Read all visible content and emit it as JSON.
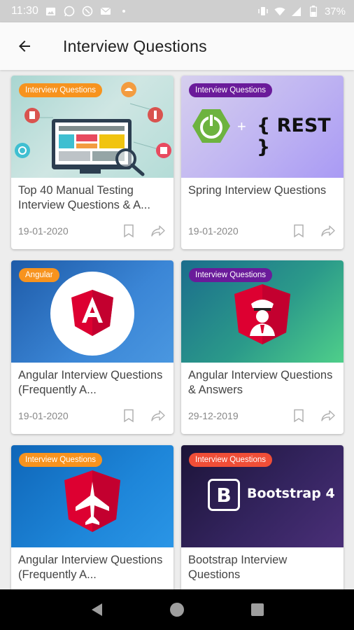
{
  "status_bar": {
    "time": "11:30",
    "battery": "37%"
  },
  "app_bar": {
    "title": "Interview Questions"
  },
  "colors": {
    "tag_orange": "#f7931e",
    "tag_purple": "#6a1b9a",
    "tag_red": "#f04e37"
  },
  "cards": [
    {
      "tag": "Interview Questions",
      "title": "Top 40 Manual Testing Interview Questions & A...",
      "date": "19-01-2020",
      "image": "manual-testing-illustration"
    },
    {
      "tag": "Interview Questions",
      "title": "Spring Interview Questions",
      "date": "19-01-2020",
      "image": "spring-rest-logo",
      "image_text": "{ REST }",
      "plus": "+"
    },
    {
      "tag": "Angular",
      "title": "Angular Interview Questions (Frequently A...",
      "date": "19-01-2020",
      "image": "angular-logo"
    },
    {
      "tag": "Interview Questions",
      "title": "Angular Interview Questions & Answers",
      "date": "29-12-2019",
      "image": "angular-officer-logo"
    },
    {
      "tag": "Interview Questions",
      "title": "Angular Interview Questions (Frequently A...",
      "date": "",
      "image": "angular-jet-logo"
    },
    {
      "tag": "Interview Questions",
      "title": "Bootstrap Interview Questions",
      "date": "",
      "image": "bootstrap-logo",
      "image_text": "Bootstrap 4",
      "logo_letter": "B"
    }
  ]
}
